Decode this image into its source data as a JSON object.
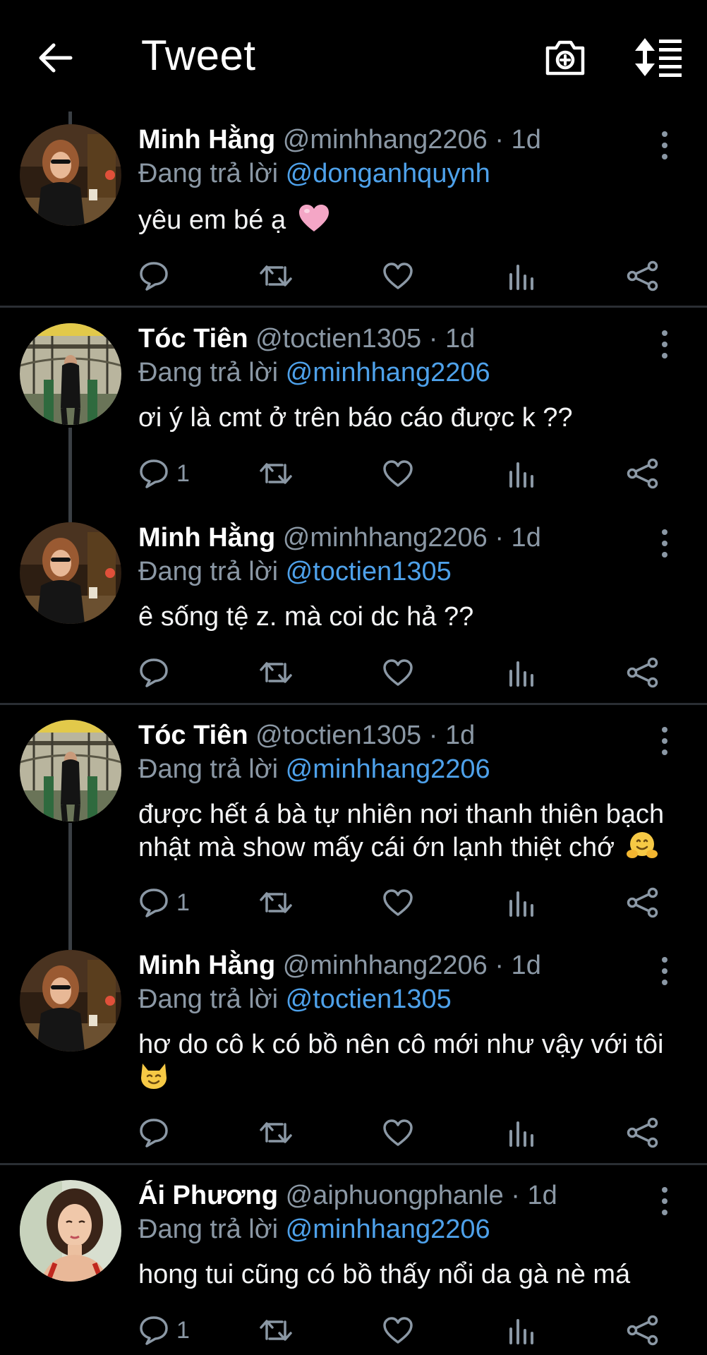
{
  "header": {
    "title": "Tweet",
    "icons": [
      "back-arrow-icon",
      "add-photo-camera-icon",
      "sort-replies-icon"
    ]
  },
  "colors": {
    "background": "#000000",
    "text": "#ffffff",
    "secondary": "#8b98a5",
    "mention": "#4ea1ea",
    "divider": "#2a2e33"
  },
  "replies": [
    {
      "name": "Minh Hằng",
      "handle": "@minhhang2206",
      "time": "· 1d",
      "replying_label": "Đang trả lời",
      "replying_to": "@donganhquynh",
      "text": "yêu em bé ạ",
      "emoji": "pink-heart-emoji",
      "reply_count": ""
    },
    {
      "name": "Tóc Tiên",
      "handle": "@toctien1305",
      "time": "· 1d",
      "replying_label": "Đang trả lời",
      "replying_to": "@minhhang2206",
      "text": "ơi ý là cmt ở trên báo cáo được k ??",
      "emoji": "",
      "reply_count": "1"
    },
    {
      "name": "Minh Hằng",
      "handle": "@minhhang2206",
      "time": "· 1d",
      "replying_label": "Đang trả lời",
      "replying_to": "@toctien1305",
      "text": "ê sống tệ z. mà coi dc hả ??",
      "emoji": "",
      "reply_count": ""
    },
    {
      "name": "Tóc Tiên",
      "handle": "@toctien1305",
      "time": "· 1d",
      "replying_label": "Đang trả lời",
      "replying_to": "@minhhang2206",
      "text": "được hết á bà tự nhiên nơi thanh thiên bạch nhật mà show mấy cái ớn lạnh thiệt chớ",
      "emoji": "hugging-face-emoji",
      "reply_count": "1"
    },
    {
      "name": "Minh Hằng",
      "handle": "@minhhang2206",
      "time": "· 1d",
      "replying_label": "Đang trả lời",
      "replying_to": "@toctien1305",
      "text": "hơ do cô k có bồ nên cô mới như vậy với tôi",
      "emoji": "smiling-cat-emoji",
      "reply_count": ""
    },
    {
      "name": "Ái Phương",
      "handle": "@aiphuongphanle",
      "time": "· 1d",
      "replying_label": "Đang trả lời",
      "replying_to": "@minhhang2206",
      "text": "hong tui cũng có bồ thấy nổi da gà nè má",
      "emoji": "",
      "reply_count": "1"
    }
  ]
}
